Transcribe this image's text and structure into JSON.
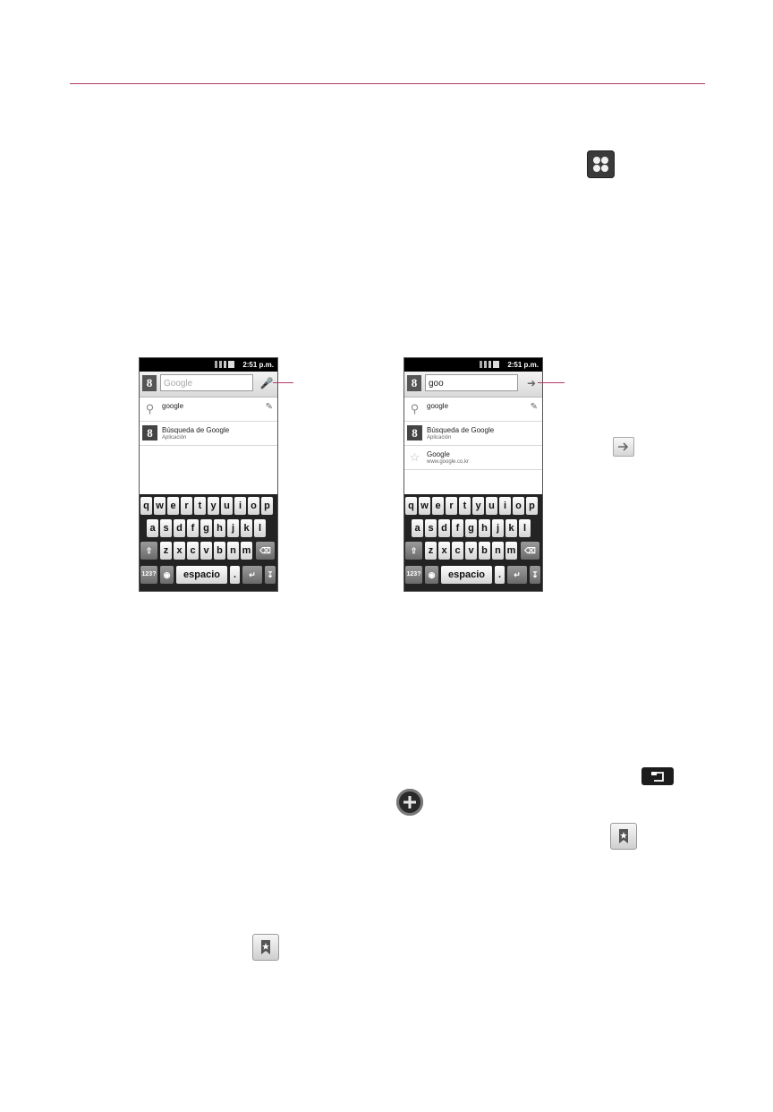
{
  "phone_left": {
    "status_time": "2:51 p.m.",
    "search_placeholder": "Google",
    "google_badge": "8",
    "action_icon": "mic-icon",
    "rows": [
      {
        "icon": "search-icon",
        "title": "google",
        "subtitle": ""
      },
      {
        "icon": "google-app-icon",
        "title": "Búsqueda de Google",
        "subtitle": "Aplicación"
      }
    ]
  },
  "phone_right": {
    "status_time": "2:51 p.m.",
    "search_value": "goo",
    "google_badge": "8",
    "action_icon": "arrow-right-icon",
    "rows": [
      {
        "icon": "search-icon",
        "title": "google",
        "subtitle": ""
      },
      {
        "icon": "google-app-icon",
        "title": "Búsqueda de Google",
        "subtitle": "Aplicación"
      },
      {
        "icon": "star-icon",
        "title": "Google",
        "subtitle": "www.google.co.kr"
      }
    ]
  },
  "keyboard": {
    "row1": [
      "q",
      "w",
      "e",
      "r",
      "t",
      "y",
      "u",
      "i",
      "o",
      "p"
    ],
    "row2": [
      "a",
      "s",
      "d",
      "f",
      "g",
      "h",
      "j",
      "k",
      "l"
    ],
    "row3": [
      "z",
      "x",
      "c",
      "v",
      "b",
      "n",
      "m"
    ],
    "symbols_key": "123?",
    "space_key": "espacio",
    "period_key": "."
  },
  "colors": {
    "accent_rule": "#b23a6a",
    "keyboard_bg": "#232323"
  }
}
